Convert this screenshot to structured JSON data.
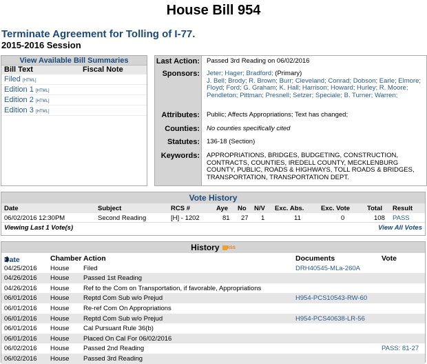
{
  "header": {
    "title": "House Bill 954",
    "bill_name": "Terminate Agreement for Tolling of I-77.",
    "session": "2015-2016 Session"
  },
  "summaries": {
    "heading": "View Available Bill Summaries",
    "col_bill_text": "Bill Text",
    "col_fiscal_note": "Fiscal Note",
    "items": [
      {
        "label": "Filed",
        "tag": "[HTML]"
      },
      {
        "label": "Edition 1",
        "tag": "[HTML]"
      },
      {
        "label": "Edition 2",
        "tag": "[HTML]"
      },
      {
        "label": "Edition 3",
        "tag": "[HTML]"
      }
    ]
  },
  "info": {
    "last_action_label": "Last Action:",
    "last_action": "Passed 3rd Reading on 06/02/2016",
    "sponsors_label": "Sponsors:",
    "primary_sponsors": "Jeter;  Hager;  Bradford;",
    "primary_tag": "(Primary)",
    "sponsors": "J. Bell;  Brody;  R. Brown;  Burr;  Cleveland;  Conrad;  Dobson;  Earle;  Elmore;  Floyd;  Ford;  G. Graham;  K. Hall;  Harrison;  Howard;  Hurley;  R. Moore;  Pendleton;  Pittman;  Presnell;  Setzer;  Speciale;  B. Turner;  Warren;",
    "attributes_label": "Attributes:",
    "attributes": "Public; Affects Appropriations; Text has changed;",
    "counties_label": "Counties:",
    "counties": "No counties specifically cited",
    "statutes_label": "Statutes:",
    "statutes": "136-18 (Section)",
    "keywords_label": "Keywords:",
    "keywords": "APPROPRIATIONS, BRIDGES, BUDGETING, CONSTRUCTION, CONTRACTS, COUNTIES, IREDELL COUNTY, MECKLENBURG COUNTY, PUBLIC, ROADS & HIGHWAYS, TOLL ROADS & BRIDGES, TRANSPORTATION, TRANSPORTATION DEPT."
  },
  "vote_history": {
    "heading": "Vote History",
    "columns": [
      "Date",
      "Subject",
      "RCS #",
      "Aye",
      "No",
      "N/V",
      "Exc. Abs.",
      "Exc. Vote",
      "Total",
      "Result"
    ],
    "rows": [
      [
        "06/02/2016 12:30PM",
        "Second Reading",
        "[H] - 1202",
        "81",
        "27",
        "1",
        "11",
        "0",
        "108",
        "PASS"
      ]
    ],
    "footer_left": "Viewing Last 1 Vote(s)",
    "footer_right": "View All Votes"
  },
  "history": {
    "heading": "History",
    "rss_label": "RSS",
    "sort_icon": "⬍",
    "columns": [
      "Date",
      "Chamber",
      "Action",
      "Documents",
      "Vote"
    ],
    "rows": [
      [
        "04/25/2016",
        "House",
        "Filed",
        "DRH40545-MLa-260A",
        ""
      ],
      [
        "04/26/2016",
        "House",
        "Passed 1st Reading",
        "",
        ""
      ],
      [
        "04/26/2016",
        "House",
        "Ref to the Com on Transportation, if favorable, Appropriations",
        "",
        ""
      ],
      [
        "06/01/2016",
        "House",
        "Reptd Com Sub w/o Prejud",
        "H954-PCS10543-RW-60",
        ""
      ],
      [
        "06/01/2016",
        "House",
        "Re-ref Com On Appropriations",
        "",
        ""
      ],
      [
        "06/01/2016",
        "House",
        "Reptd Com Sub w/o Prejud",
        "H954-PCS40638-LR-56",
        ""
      ],
      [
        "06/01/2016",
        "House",
        "Cal Pursuant Rule 36(b)",
        "",
        ""
      ],
      [
        "06/01/2016",
        "House",
        "Placed On Cal For 06/02/2016",
        "",
        ""
      ],
      [
        "06/02/2016",
        "House",
        "Passed 2nd Reading",
        "",
        "PASS: 81-27"
      ],
      [
        "06/02/2016",
        "House",
        "Passed 3rd Reading",
        "",
        ""
      ]
    ]
  }
}
